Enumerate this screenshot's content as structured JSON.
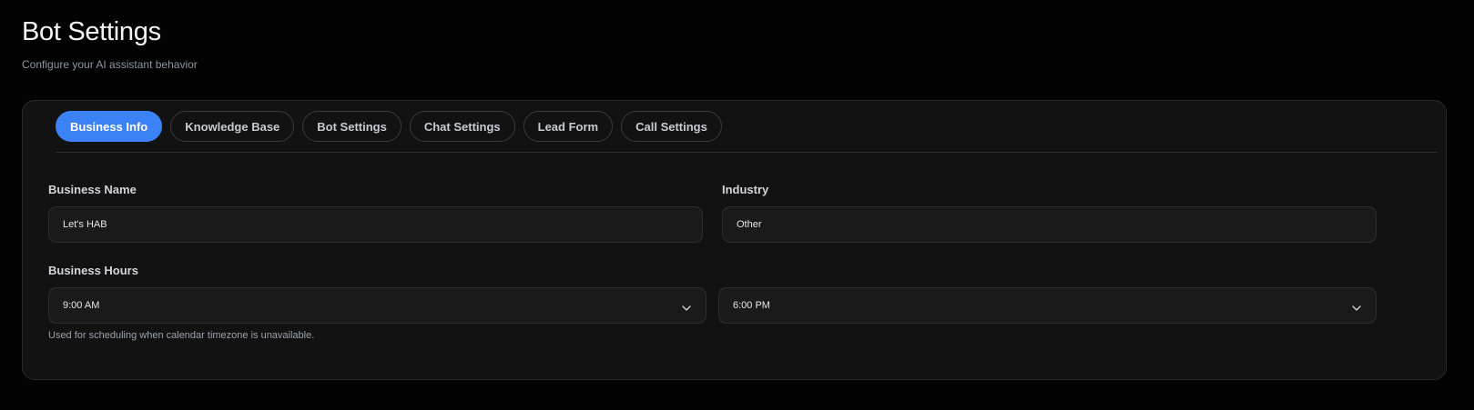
{
  "header": {
    "title": "Bot Settings",
    "subtitle": "Configure your AI assistant behavior"
  },
  "tabs": [
    {
      "label": "Business Info",
      "active": true
    },
    {
      "label": "Knowledge Base",
      "active": false
    },
    {
      "label": "Bot Settings",
      "active": false
    },
    {
      "label": "Chat Settings",
      "active": false
    },
    {
      "label": "Lead Form",
      "active": false
    },
    {
      "label": "Call Settings",
      "active": false
    }
  ],
  "form": {
    "business_name": {
      "label": "Business Name",
      "value": "Let's HAB"
    },
    "industry": {
      "label": "Industry",
      "value": "Other"
    },
    "business_hours": {
      "label": "Business Hours",
      "open": "9:00 AM",
      "close": "6:00 PM",
      "help": "Used for scheduling when calendar timezone is unavailable."
    }
  },
  "colors": {
    "accent": "#3b82f6",
    "background": "#030303",
    "card": "#121212"
  }
}
